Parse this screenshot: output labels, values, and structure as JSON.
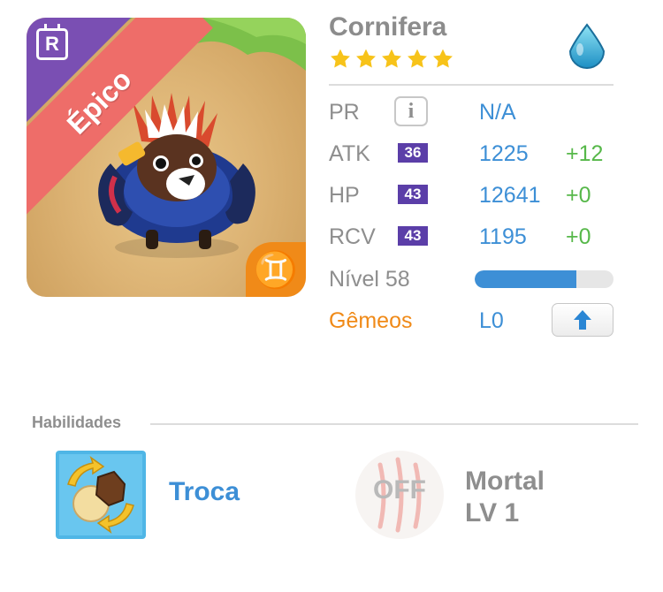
{
  "portrait": {
    "rarity_letter": "R",
    "rarity_label": "Épico",
    "zodiac_glyph": "♊",
    "creature_icon": "horned-ram-creature-illustration"
  },
  "monster": {
    "name": "Cornifera",
    "stars": 5,
    "element_icon": "water-drop-icon"
  },
  "stats": [
    {
      "label": "PR",
      "badge": "",
      "info_glyph": "i",
      "value": "N/A",
      "bonus": ""
    },
    {
      "label": "ATK",
      "badge": "36",
      "value": "1225",
      "bonus": "+12"
    },
    {
      "label": "HP",
      "badge": "43",
      "value": "12641",
      "bonus": "+0"
    },
    {
      "label": "RCV",
      "badge": "43",
      "value": "1195",
      "bonus": "+0"
    }
  ],
  "level": {
    "label": "Nível 58",
    "progress": 0.73
  },
  "zodiac": {
    "label": "Gêmeos",
    "value": "L0",
    "upgrade_icon": "up-arrow-icon"
  },
  "abilities": {
    "title": "Habilidades",
    "active": {
      "name": "Troca",
      "icon": "swap-orbs-icon"
    },
    "passive": {
      "state": "OFF",
      "name_line1": "Mortal",
      "name_line2": "LV 1",
      "icon": "claw-marks-icon"
    }
  },
  "colors": {
    "accent_blue": "#3d8fd6",
    "bonus_green": "#57b84a",
    "zodiac_orange": "#f08a18",
    "badge_purple": "#5b3ea8",
    "ribbon_red": "#ee6d69",
    "corner_purple": "#7a4fb3",
    "star_yellow": "#f7c31a",
    "label_gray": "#8e8e8e"
  }
}
